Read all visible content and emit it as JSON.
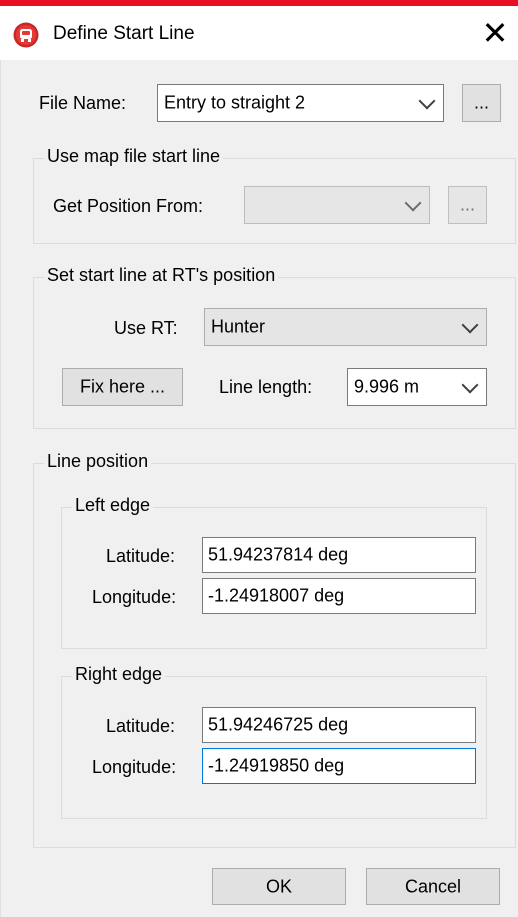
{
  "window": {
    "title": "Define Start Line",
    "accent": "#e81123",
    "icon": "app-icon"
  },
  "file": {
    "label": "File Name:",
    "value": "Entry to straight 2",
    "browse": "..."
  },
  "mapfile": {
    "title": "Use map file start line",
    "get_label": "Get Position From:",
    "get_value": "",
    "browse": "..."
  },
  "rt": {
    "title": "Set start line at RT's position",
    "use_label": "Use RT:",
    "use_value": "Hunter",
    "fix_label": "Fix here ...",
    "length_label": "Line length:",
    "length_value": "9.996 m"
  },
  "line": {
    "title": "Line position",
    "left": {
      "title": "Left edge",
      "lat_label": "Latitude:",
      "lat_value": "51.94237814 deg",
      "lon_label": "Longitude:",
      "lon_value": "-1.24918007 deg"
    },
    "right": {
      "title": "Right edge",
      "lat_label": "Latitude:",
      "lat_value": "51.94246725 deg",
      "lon_label": "Longitude:",
      "lon_value": "-1.24919850 deg"
    }
  },
  "buttons": {
    "ok": "OK",
    "cancel": "Cancel"
  }
}
